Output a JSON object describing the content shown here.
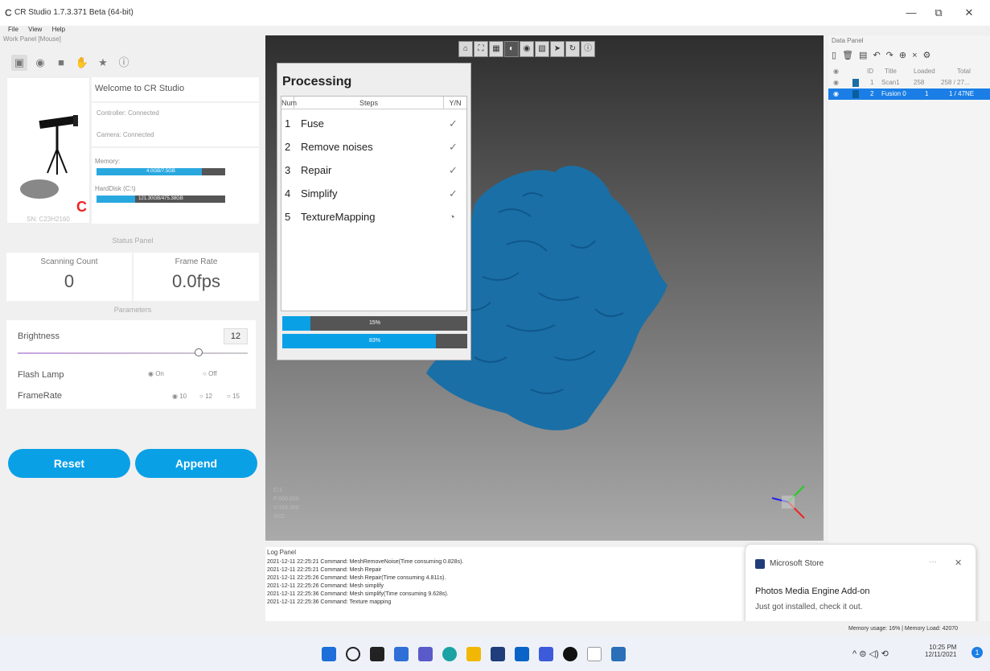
{
  "window": {
    "title": "CR Studio 1.7.3.371 Beta (64-bit)",
    "min": "—",
    "max": "⧉",
    "close": "✕"
  },
  "menu": [
    "File",
    "View",
    "Help"
  ],
  "work_panel": {
    "header": "Work Panel [Mouse]",
    "tool_icons": [
      "cube-icon",
      "eye-icon",
      "camera-icon",
      "hand-icon",
      "star-icon",
      "info-icon"
    ],
    "device_sn": "SN: C23H2160",
    "welcome": "Welcome to CR Studio",
    "controller": "Controller: Connected",
    "camera": "Camera: Connected",
    "memory_label": "Memory:",
    "memory_value": "4.0GB/7.5GB",
    "memory_fraction": 0.82,
    "harddisk_label": "HardDisk (C:\\)",
    "harddisk_value": "121.30GB/475.38GB",
    "harddisk_fraction": 0.3
  },
  "status_panel": {
    "title": "Status Panel",
    "scanning_count_label": "Scanning Count",
    "scanning_count_value": "0",
    "frame_rate_label": "Frame Rate",
    "frame_rate_value": "0.0fps"
  },
  "parameters": {
    "title": "Parameters",
    "brightness_label": "Brightness",
    "brightness_value": "12",
    "flash_label": "Flash Lamp",
    "flash_on": "On",
    "flash_off": "Off",
    "framerate_label": "FrameRate",
    "framerate_opts": [
      "10",
      "12",
      "15"
    ]
  },
  "buttons": {
    "reset": "Reset",
    "append": "Append"
  },
  "processing": {
    "title": "Processing",
    "col_num": "Num",
    "col_steps": "Steps",
    "col_yn": "Y/N",
    "steps": [
      {
        "n": "1",
        "name": "Fuse",
        "status": "✓"
      },
      {
        "n": "2",
        "name": "Remove noises",
        "status": "✓"
      },
      {
        "n": "3",
        "name": "Repair",
        "status": "✓"
      },
      {
        "n": "4",
        "name": "Simplify",
        "status": "✓"
      },
      {
        "n": "5",
        "name": "TextureMapping",
        "status": "◔"
      }
    ],
    "progress1_label": "15%",
    "progress1": 0.15,
    "progress2_label": "83%",
    "progress2": 0.83
  },
  "viewport_info": [
    "C:1",
    "F:000.000",
    "V:165.000",
    "3VO"
  ],
  "data_panel": {
    "header": "Data Panel",
    "cols": [
      "ID",
      "Title",
      "Loaded",
      "Total"
    ],
    "rows": [
      {
        "id": "1",
        "title": "Scan1",
        "loaded": "258",
        "total": "258 / 27..."
      },
      {
        "id": "2",
        "title": "Fusion 0",
        "loaded": "1",
        "total": "1 / 47NE"
      }
    ]
  },
  "log": {
    "header": "Log Panel",
    "lines": [
      "2021-12-11 22:25:21 Command: MeshRemoveNoise(Time consuming 0.828s).",
      "2021-12-11 22:25:21 Command: Mesh Repair",
      "2021-12-11 22:25:26 Command: Mesh Repair(Time consuming 4.811s).",
      "2021-12-11 22:25:26 Command: Mesh simplify",
      "2021-12-11 22:25:36 Command: Mesh simplify(Time consuming 9.628s).",
      "2021-12-11 22:25:36 Command: Texture mapping"
    ]
  },
  "toast": {
    "app": "Microsoft Store",
    "title": "Photos Media Engine Add-on",
    "body": "Just got installed, check it out."
  },
  "statusbar": {
    "memory": "Memory usage: 16% | Memory Load: 42070"
  },
  "taskbar": {
    "time": "10:25 PM",
    "date": "12/11/2021",
    "badge": "1"
  },
  "colors": {
    "accent": "#0aa0e6",
    "scan_mesh": "#1a6fa6",
    "selected_row": "#1a7ee6"
  }
}
